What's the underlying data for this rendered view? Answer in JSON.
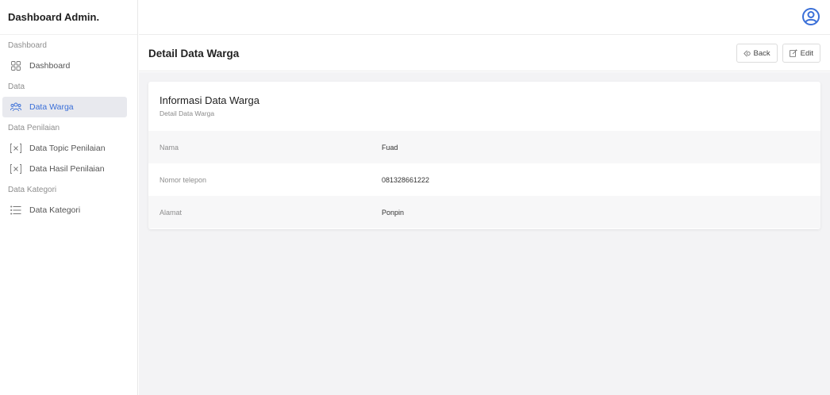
{
  "brand": "Dashboard Admin.",
  "sidebar": {
    "sections": [
      {
        "label": "Dashboard"
      },
      {
        "label": "Data"
      },
      {
        "label": "Data Penilaian"
      },
      {
        "label": "Data Kategori"
      }
    ],
    "items": [
      {
        "label": "Dashboard",
        "icon": "grid-icon"
      },
      {
        "label": "Data Warga",
        "icon": "people-icon",
        "active": true
      },
      {
        "label": "Data Topic Penilaian",
        "icon": "x-bracket-icon"
      },
      {
        "label": "Data Hasil Penilaian",
        "icon": "x-bracket-icon"
      },
      {
        "label": "Data Kategori",
        "icon": "list-icon"
      }
    ]
  },
  "header": {
    "title": "Detail Data Warga",
    "back_label": "Back",
    "edit_label": "Edit"
  },
  "card": {
    "title": "Informasi Data Warga",
    "subtitle": "Detail Data Warga",
    "rows": [
      {
        "key": "Nama",
        "value": "Fuad"
      },
      {
        "key": "Nomor telepon",
        "value": "081328661222"
      },
      {
        "key": "Alamat",
        "value": "Ponpin"
      }
    ]
  },
  "colors": {
    "accent": "#3a6fd8",
    "active_bg": "#e8e9ee",
    "content_bg": "#f3f3f5"
  }
}
